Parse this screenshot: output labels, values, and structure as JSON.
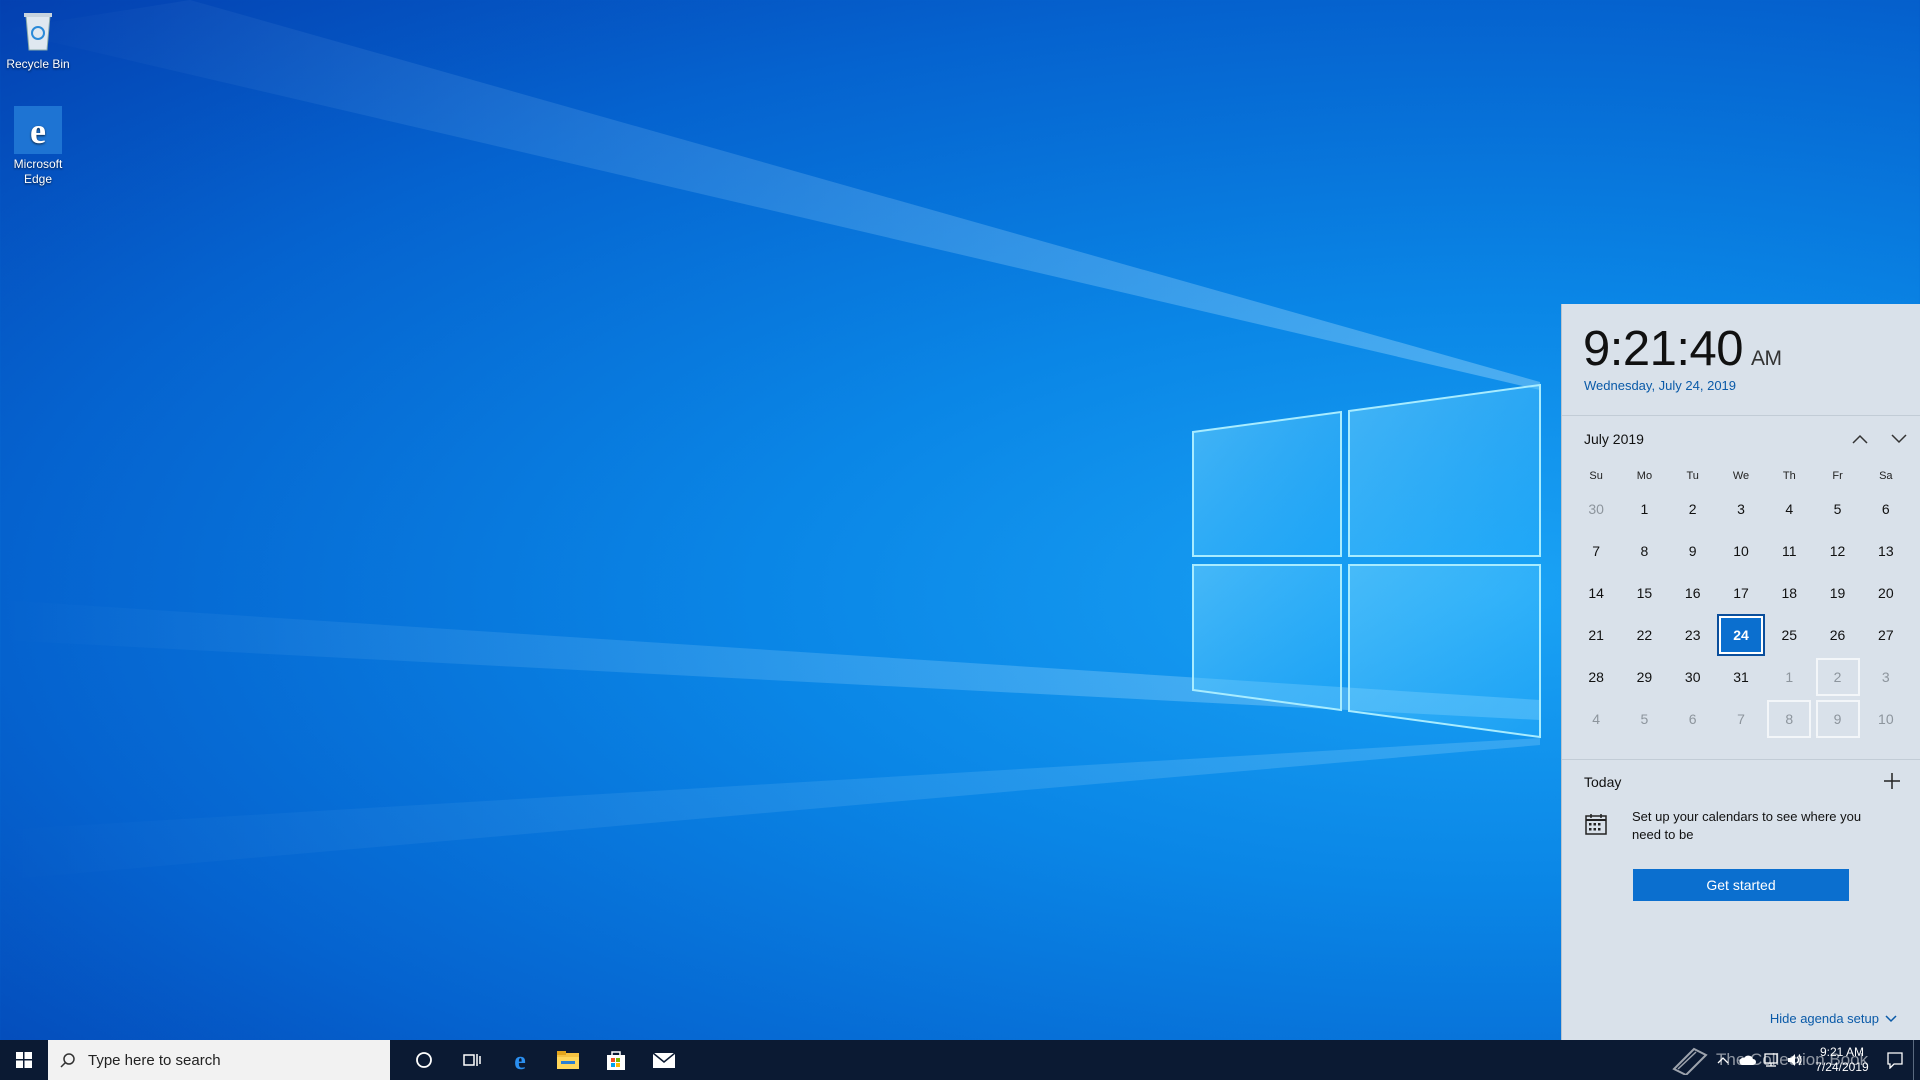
{
  "desktop": {
    "icons": [
      {
        "label": "Recycle Bin"
      },
      {
        "label": "Microsoft Edge"
      }
    ]
  },
  "flyout": {
    "time": "9:21:40",
    "ampm": "AM",
    "date_long": "Wednesday, July 24, 2019",
    "month_label": "July 2019",
    "weekdays": [
      "Su",
      "Mo",
      "Tu",
      "We",
      "Th",
      "Fr",
      "Sa"
    ],
    "weeks": [
      [
        "30",
        "1",
        "2",
        "3",
        "4",
        "5",
        "6"
      ],
      [
        "7",
        "8",
        "9",
        "10",
        "11",
        "12",
        "13"
      ],
      [
        "14",
        "15",
        "16",
        "17",
        "18",
        "19",
        "20"
      ],
      [
        "21",
        "22",
        "23",
        "24",
        "25",
        "26",
        "27"
      ],
      [
        "28",
        "29",
        "30",
        "31",
        "1",
        "2",
        "3"
      ],
      [
        "4",
        "5",
        "6",
        "7",
        "8",
        "9",
        "10"
      ]
    ],
    "agenda_title": "Today",
    "agenda_message": "Set up your calendars to see where you need to be",
    "get_started_label": "Get started",
    "hide_setup_label": "Hide agenda setup"
  },
  "taskbar": {
    "search_placeholder": "Type here to search",
    "clock_time": "9:21 AM",
    "clock_date": "7/24/2019",
    "watermark": "The Collection Book"
  },
  "colors": {
    "accent": "#0b6fcf",
    "taskbar": "#0b1a33",
    "flyout_bg": "#d9e1ea"
  }
}
